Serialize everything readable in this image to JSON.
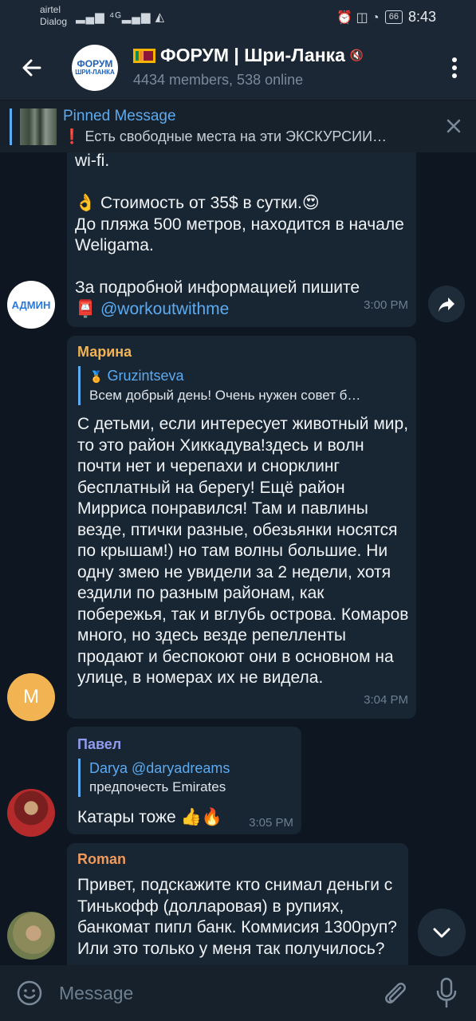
{
  "status_bar": {
    "carrier1": "airtel",
    "carrier2": "Dialog",
    "signal_text": "▂▄▆ ⁴ᴳ▂▄▆ ◭",
    "right_icons": "⏰ ◫ ◔",
    "battery": "66",
    "time": "8:43"
  },
  "header": {
    "avatar_line1": "ФОРУМ",
    "avatar_line2": "ШРИ-ЛАНКА",
    "title": "ФОРУМ | Шри-Ланка",
    "mute_symbol": "🔇",
    "subtitle": "4434 members, 538 online"
  },
  "pinned": {
    "label": "Pinned Message",
    "mark": "❗",
    "text": "Есть свободные места на эти ЭКСКУРСИИ…"
  },
  "messages": [
    {
      "avatar_text": "АДМИН",
      "text1": "wi-fi.\n\n👌 Стоимость от 35$ в сутки.😍\nДо пляжа 500 метров, находится в начале Weligama.\n\nЗа подробной информацией пишите\n📮 ",
      "link": "@workoutwithme",
      "time": "3:00 PM"
    },
    {
      "sender": "Марина",
      "sender_color": "#f2b453",
      "avatar_text": "М",
      "reply_name": "Gruzintseva",
      "reply_text": "Всем добрый день! Очень нужен совет б…",
      "text": "С детьми, если интересует животный мир, то это район Хиккадува!здесь и волн почти нет и черепахи и снорклинг бесплатный на берегу! Ещё район Мирриса понравился! Там и павлины везде, птички разные, обезьянки носятся по крышам!) но там волны большие. Ни одну змею не увидели за 2 недели, хотя ездили по разным районам, как побережья, так и вглубь острова. Комаров много, но здесь везде репелленты продают и беспокоют они в основном на улице, в номерах их не видела.",
      "time": "3:04 PM"
    },
    {
      "sender": "Павел",
      "sender_color": "#8f9cf0",
      "reply_name": "Darya @daryadreams",
      "reply_text": "предпочесть Emirates",
      "text": "Катары тоже 👍🔥",
      "time": "3:05 PM"
    },
    {
      "sender": "Roman",
      "sender_color": "#f09a5c",
      "text": "Привет, подскажите кто снимал деньги с Тинькофф (долларовая) в рупиях, банкомат пипл банк. Коммисия 1300руп? Или это только у меня так получилось?"
    }
  ],
  "input": {
    "placeholder": "Message"
  }
}
